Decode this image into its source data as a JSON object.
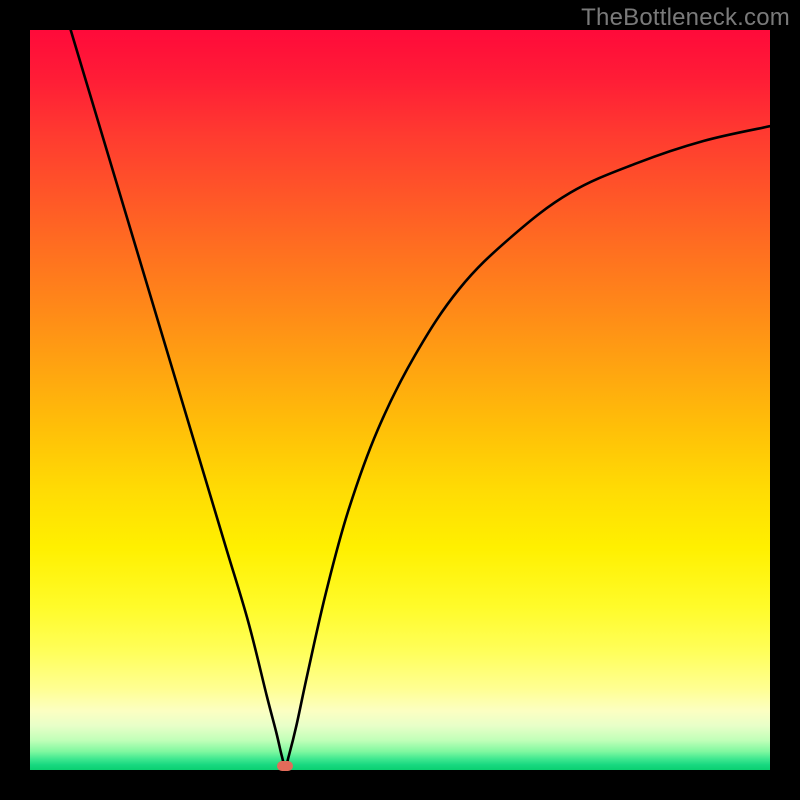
{
  "attribution": "TheBottleneck.com",
  "chart_data": {
    "type": "line",
    "title": "",
    "xlabel": "",
    "ylabel": "",
    "x_range": [
      0,
      1
    ],
    "y_range": [
      0,
      1
    ],
    "series": [
      {
        "name": "bottleneck-curve",
        "color": "#000000",
        "points": [
          {
            "x": 0.055,
            "y": 1.0
          },
          {
            "x": 0.085,
            "y": 0.9
          },
          {
            "x": 0.115,
            "y": 0.8
          },
          {
            "x": 0.145,
            "y": 0.7
          },
          {
            "x": 0.175,
            "y": 0.6
          },
          {
            "x": 0.205,
            "y": 0.5
          },
          {
            "x": 0.235,
            "y": 0.4
          },
          {
            "x": 0.265,
            "y": 0.3
          },
          {
            "x": 0.295,
            "y": 0.2
          },
          {
            "x": 0.32,
            "y": 0.1
          },
          {
            "x": 0.333,
            "y": 0.05
          },
          {
            "x": 0.34,
            "y": 0.02
          },
          {
            "x": 0.345,
            "y": 0.005
          },
          {
            "x": 0.35,
            "y": 0.02
          },
          {
            "x": 0.36,
            "y": 0.06
          },
          {
            "x": 0.375,
            "y": 0.13
          },
          {
            "x": 0.4,
            "y": 0.24
          },
          {
            "x": 0.43,
            "y": 0.35
          },
          {
            "x": 0.47,
            "y": 0.46
          },
          {
            "x": 0.52,
            "y": 0.56
          },
          {
            "x": 0.58,
            "y": 0.65
          },
          {
            "x": 0.65,
            "y": 0.72
          },
          {
            "x": 0.73,
            "y": 0.78
          },
          {
            "x": 0.82,
            "y": 0.82
          },
          {
            "x": 0.91,
            "y": 0.85
          },
          {
            "x": 1.0,
            "y": 0.87
          }
        ]
      }
    ],
    "marker": {
      "name": "optimal-point",
      "x": 0.345,
      "y": 0.005,
      "color": "#e26b5a"
    },
    "gradient_bands": [
      {
        "stop": 0.0,
        "color": "#ff0a3a",
        "meaning": "worst"
      },
      {
        "stop": 0.5,
        "color": "#ffc008",
        "meaning": "mid"
      },
      {
        "stop": 0.85,
        "color": "#ffff5a",
        "meaning": "good"
      },
      {
        "stop": 1.0,
        "color": "#0ad070",
        "meaning": "best"
      }
    ]
  }
}
